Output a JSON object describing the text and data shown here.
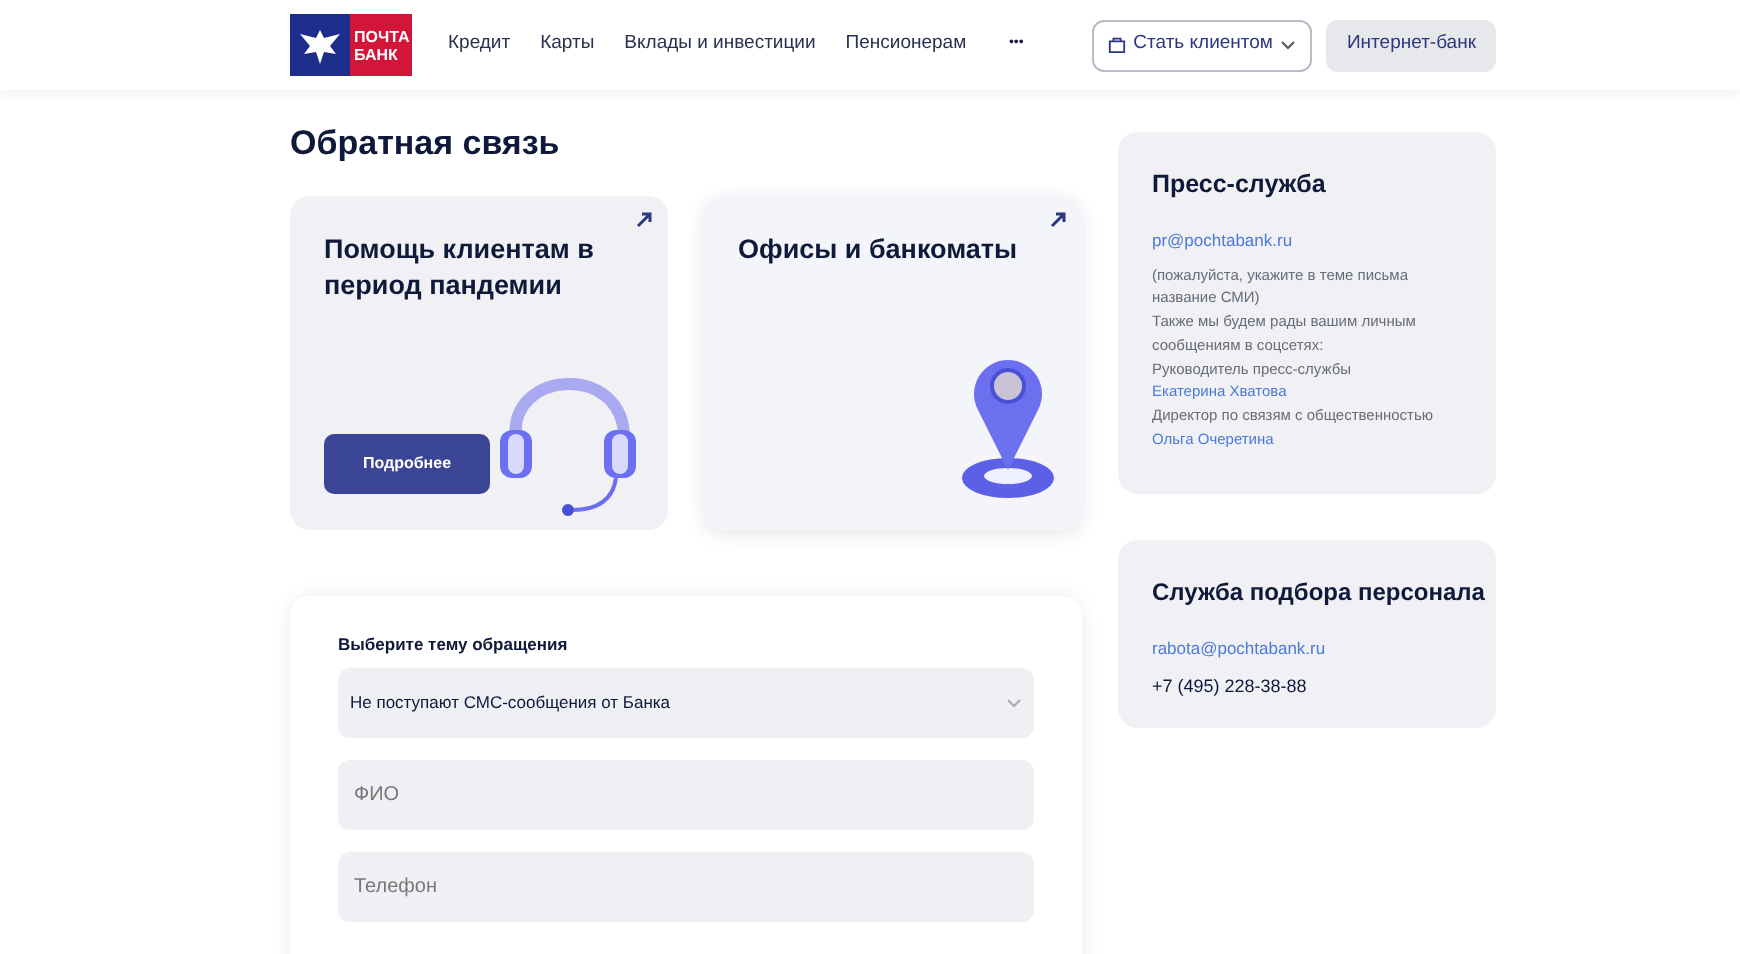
{
  "header": {
    "logo": {
      "line1": "ПОЧТА",
      "line2": "БАНК"
    },
    "nav": [
      {
        "label": "Кредит"
      },
      {
        "label": "Карты"
      },
      {
        "label": "Вклады и инвестиции"
      },
      {
        "label": "Пенсионерам"
      }
    ],
    "more": "•••",
    "become_client": "Стать клиентом",
    "internet_bank": "Интернет-банк"
  },
  "title": "Обратная связь",
  "cards": [
    {
      "kind": "headset",
      "title": "Помощь клиентам в период пандемии",
      "button": "Подробнее"
    },
    {
      "kind": "pin",
      "title": "Офисы и банкоматы"
    }
  ],
  "form": {
    "topic_label": "Выберите тему обращения",
    "topic_value": "Не поступают СМС-сообщения от Банка",
    "fields": [
      {
        "placeholder": "ФИО"
      },
      {
        "placeholder": "Телефон"
      }
    ]
  },
  "press": {
    "title": "Пресс-служба",
    "email": "pr@pochtabank.ru",
    "lines": [
      {
        "text": "(пожалуйста, укажите в теме письма название СМИ)"
      },
      {
        "text": "Также мы будем рады вашим личным сообщениям в соцсетях:"
      },
      {
        "text": "Руководитель пресс-службы",
        "link": "Екатерина Хватова"
      },
      {
        "text": "Директор по связям с общественностью",
        "link": "Ольга Очеретина"
      }
    ]
  },
  "hr": {
    "title": "Служба подбора персонала",
    "email": "rabota@pochtabank.ru",
    "phone": "+7 (495) 228-38-88"
  }
}
